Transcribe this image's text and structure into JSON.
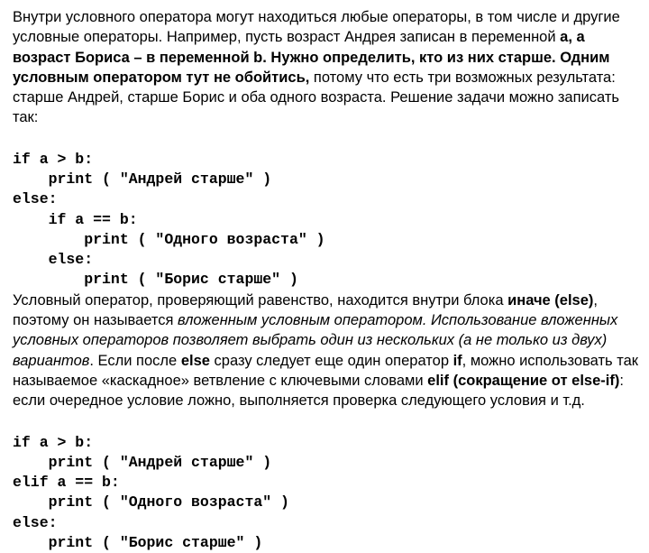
{
  "p1_a": "Внутри условного оператора могут находиться любые операторы, в том числе и другие условные операторы. Например, пусть возраст Андрея записан в переменной ",
  "p1_b": "a, а возраст Бориса – в переменной b. Нужно определить, кто из них старше. Одним условным оператором тут не обойтись, ",
  "p1_c": "потому что есть три возможных результата: старше Андрей, старше Борис и оба одного возраста. Решение задачи можно записать так:",
  "code1_l1": "if a > b:",
  "code1_l2": "    print ( \"Андрей старше\" )",
  "code1_l3": "else:",
  "code1_l4": "    if a == b:",
  "code1_l5": "        print ( \"Одного возраста\" )",
  "code1_l6": "    else:",
  "code1_l7": "        print ( \"Борис старше\" )",
  "p2_a": "Условный оператор, проверяющий равенство, находится внутри блока ",
  "p2_b": "иначе (else)",
  "p2_c": ", поэтому он называется ",
  "p2_d": "вложенным условным оператором. Использование вложенных условных операторов позволяет выбрать один из нескольких (а не только из двух) вариантов",
  "p2_e": ". Если после ",
  "p2_f": "else",
  "p2_g": " сразу следует еще один оператор ",
  "p2_h": "if",
  "p2_i": ", можно использовать так называемое «каскадное» ветвление с ключевыми словами ",
  "p2_j": "elif (сокращение от else-if)",
  "p2_k": ": если очередное условие ложно, выполняется проверка следующего условия и т.д.",
  "code2_l1": "if a > b:",
  "code2_l2": "    print ( \"Андрей старше\" )",
  "code2_l3": "elif a == b:",
  "code2_l4": "    print ( \"Одного возраста\" )",
  "code2_l5": "else:",
  "code2_l6": "    print ( \"Борис старше\" )"
}
